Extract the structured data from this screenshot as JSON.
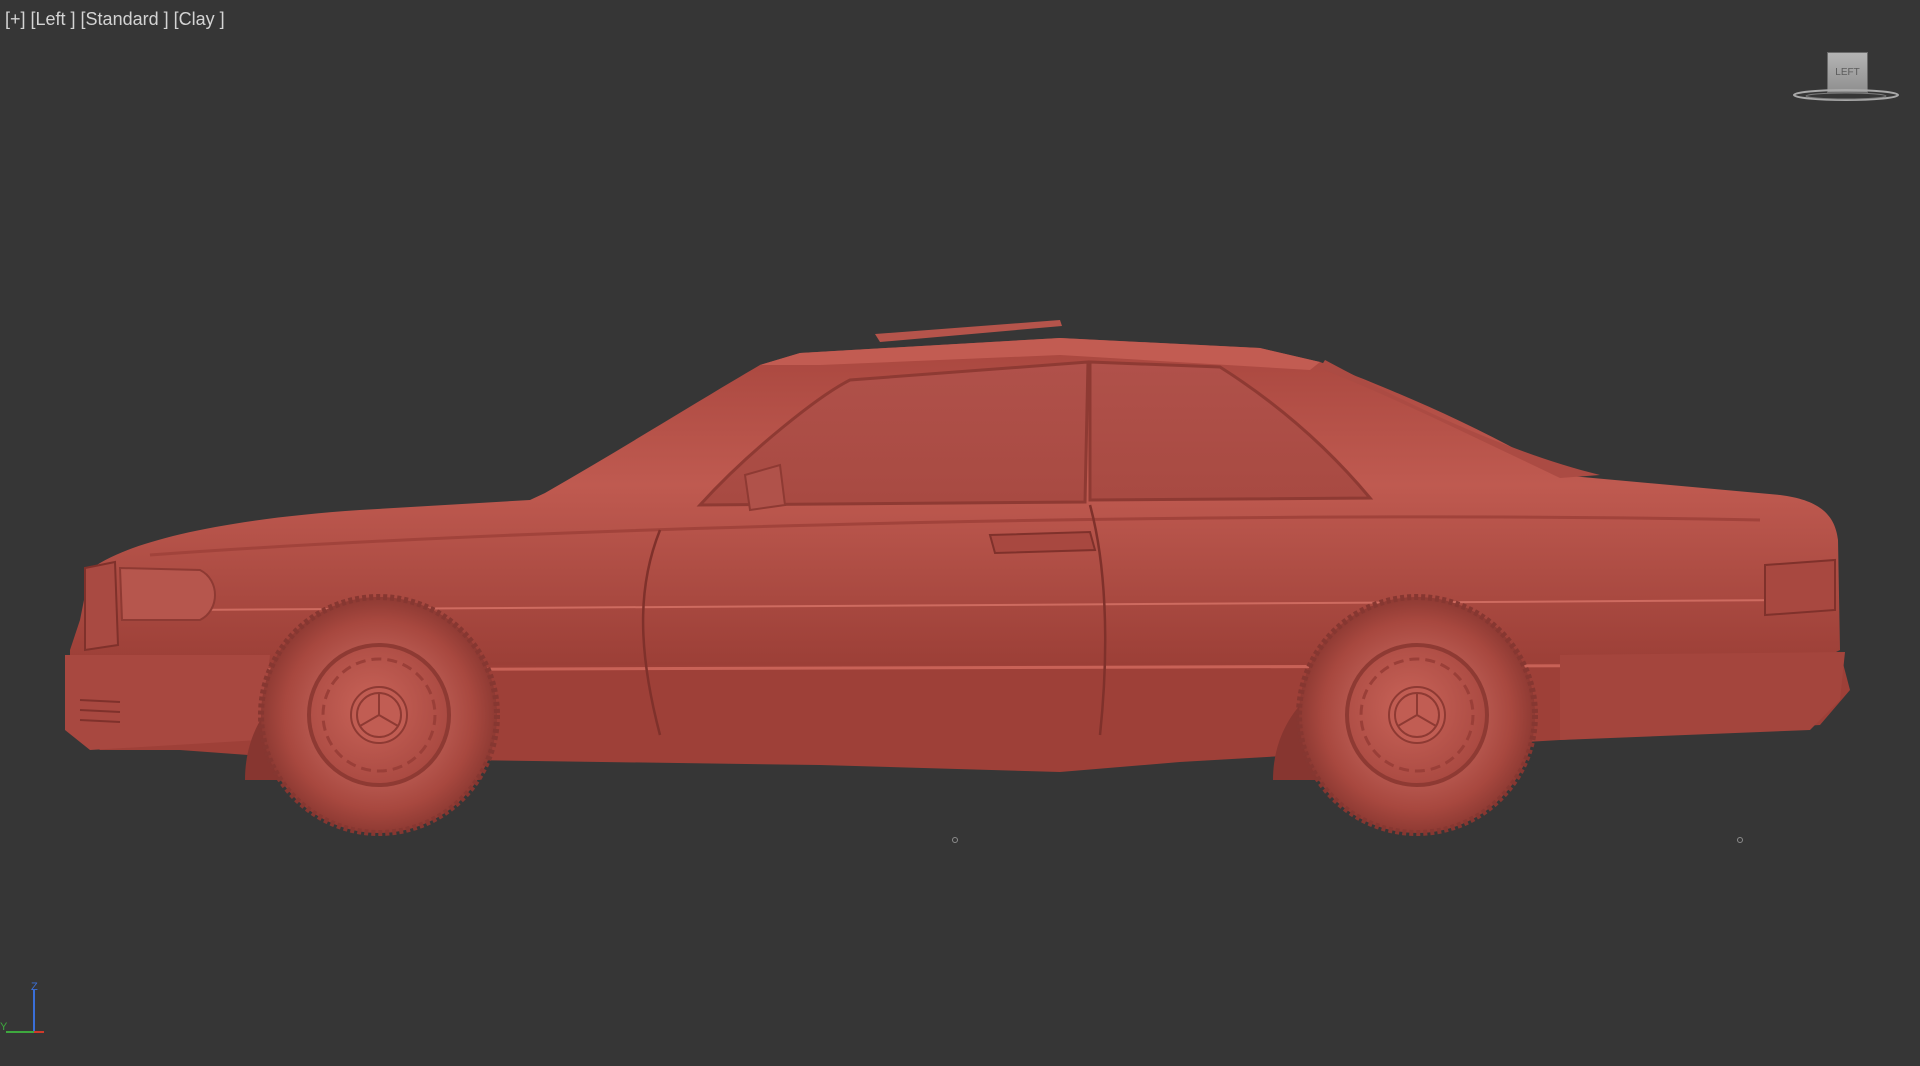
{
  "viewport": {
    "label_items": [
      "[+]",
      "[Left ]",
      "[Standard ]",
      "[Clay ]"
    ],
    "background_color": "#363636",
    "model_color": "#b8524a"
  },
  "viewcube": {
    "face_label": "LEFT",
    "icon": "viewcube-icon"
  },
  "axis_tripod": {
    "up_axis": "Z",
    "side_axis": "Y",
    "z_color": "#3a6fd8",
    "y_color": "#3ea83e",
    "x_color": "#d03a2a"
  }
}
